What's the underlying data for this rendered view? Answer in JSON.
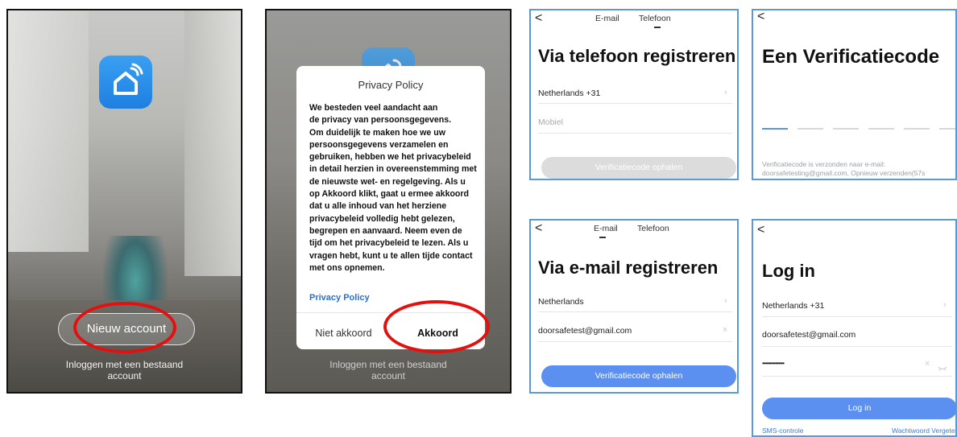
{
  "panel1": {
    "new_account": "Nieuw account",
    "login_line1": "Inloggen met een bestaand",
    "login_line2": "account"
  },
  "panel2": {
    "dialog_title": "Privacy Policy",
    "dialog_lines": [
      "We besteden veel aandacht aan",
      "de privacy van persoonsgegevens.",
      "Om duidelijk te maken hoe we uw",
      "persoonsgegevens verzamelen en",
      "gebruiken, hebben we het privacybeleid",
      "in detail herzien in overeenstemming met",
      "de nieuwste wet- en regelgeving. Als u",
      "op Akkoord klikt, gaat u ermee akkoord",
      "dat u alle inhoud van het herziene",
      "privacybeleid volledig hebt gelezen,",
      "begrepen en aanvaard. Neem even de",
      "tijd om het privacybeleid te lezen. Als u",
      "vragen hebt, kunt u te allen tijde contact",
      "met ons opnemen."
    ],
    "policy_link": "Privacy Policy",
    "disagree": "Niet akkoord",
    "agree": "Akkoord",
    "login_line1": "Inloggen met een bestaand",
    "login_line2": "account"
  },
  "card_phone": {
    "back": "<",
    "tab_email": "E-mail",
    "tab_phone": "Telefoon",
    "title": "Via telefoon registreren",
    "country": "Netherlands +31",
    "mobile_placeholder": "Mobiel",
    "button": "Verificatiecode ophalen"
  },
  "card_code": {
    "back": "<",
    "title": "Een Verificatiecode",
    "note_line1": "Verificatiecode is verzonden naar e-mail:",
    "note_line2": "doorsafetesting@gmail.com, Opnieuw verzenden(57s"
  },
  "card_email": {
    "back": "<",
    "tab_email": "E-mail",
    "tab_phone": "Telefoon",
    "title": "Via e-mail registreren",
    "country": "Netherlands",
    "email": "doorsafetest@gmail.com",
    "clear": "×",
    "button": "Verificatiecode ophalen"
  },
  "card_login": {
    "back": "<",
    "title": "Log in",
    "country": "Netherlands +31",
    "email": "doorsafetest@gmail.com",
    "password_mask": "•••••••••••••••",
    "clear": "×",
    "button": "Log in",
    "sms": "SMS-controle",
    "forgot": "Wachtwoord Vergeten"
  },
  "colors": {
    "accent_blue": "#5b8ff0",
    "disabled_grey": "#dcdcdc",
    "annotation_red": "#e41010",
    "card_border": "#5b9bd5"
  }
}
